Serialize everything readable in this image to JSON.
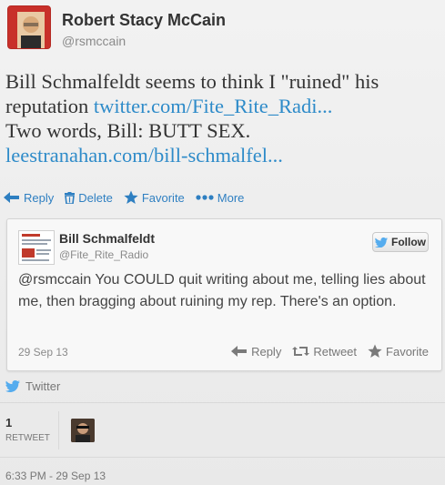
{
  "tweet": {
    "author": {
      "display_name": "Robert Stacy McCain",
      "handle": "@rsmccain"
    },
    "text_line1_plain": "Bill Schmalfeldt seems to think I \"ruined\" his",
    "text_line2_plain": "reputation ",
    "text_line2_link": "twitter.com/Fite_Rite_Radi...",
    "text_line3_plain": "Two words, Bill: BUTT SEX.",
    "text_line4_link": "leestranahan.com/bill-schmalfel...",
    "actions": {
      "reply": "Reply",
      "delete": "Delete",
      "favorite": "Favorite",
      "more": "More"
    },
    "via": "Twitter",
    "retweet_count": "1",
    "retweet_label": "RETWEET",
    "timestamp": "6:33 PM - 29 Sep 13"
  },
  "quoted": {
    "display_name": "Bill Schmalfeldt",
    "handle": "@Fite_Rite_Radio",
    "follow_label": "Follow",
    "text": "@rsmccain  You COULD quit writing about me, telling lies about me, then bragging about ruining my rep. There's an option.",
    "date": "29 Sep 13",
    "actions": {
      "reply": "Reply",
      "retweet": "Retweet",
      "favorite": "Favorite"
    }
  },
  "colors": {
    "link": "#2e8bc9",
    "action": "#2e7fc1",
    "muted": "#8a8a8a"
  },
  "icons": [
    "reply-icon",
    "trash-icon",
    "star-icon",
    "more-icon",
    "retweet-icon",
    "twitter-bird-icon"
  ]
}
